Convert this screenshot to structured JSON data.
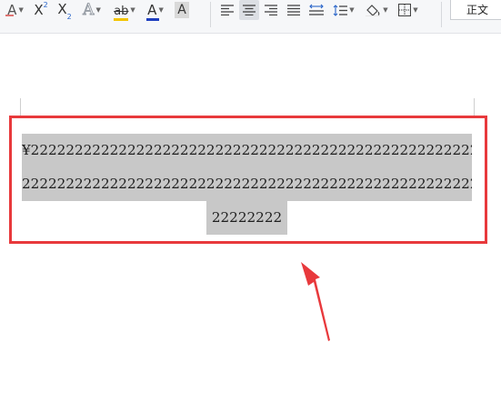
{
  "toolbar": {
    "clear_format_label": "A",
    "superscript_label": "X",
    "superscript_mark": "2",
    "subscript_label": "X",
    "subscript_mark": "2",
    "text_effect_label": "A",
    "highlight_label": "ab",
    "font_color_label": "A",
    "char_shading_label": "A",
    "style_label": "正文",
    "colors": {
      "highlight_bar": "#f3c400",
      "font_color_bar": "#1f3fbf",
      "shading_bg": "#d9d9d9"
    }
  },
  "document": {
    "lines": [
      "¥2222222222222222222222222222222222222222222222222222222",
      "22222222222222222222222222222222222222222222222222222222",
      "22222222"
    ],
    "selection_color": "#c8c8c8"
  },
  "annotation": {
    "box_color": "#e8393c",
    "arrow_color": "#e8393c"
  }
}
